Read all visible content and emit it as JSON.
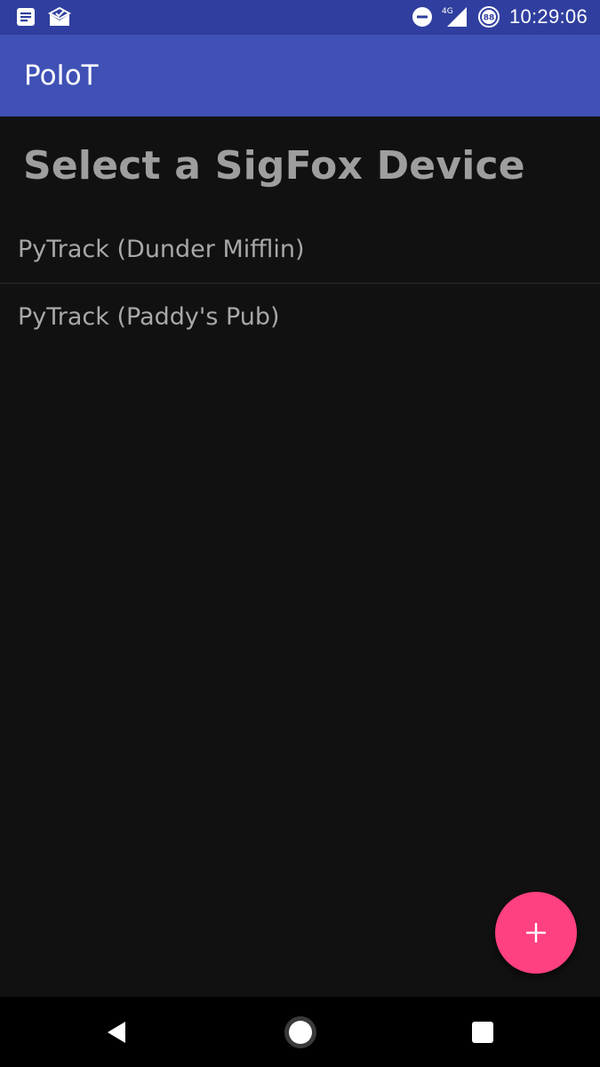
{
  "status_bar": {
    "time": "10:29:06",
    "network": "4G",
    "battery_level": "88",
    "icons_left": [
      "notes-icon",
      "mail-icon"
    ],
    "icons_right": [
      "do-not-disturb-icon",
      "signal-icon",
      "battery-icon"
    ]
  },
  "app_bar": {
    "title": "PoIoT",
    "color": "#3f51b5"
  },
  "main": {
    "heading": "Select a SigFox Device",
    "devices": [
      {
        "label": "PyTrack (Dunder Mifflin)"
      },
      {
        "label": "PyTrack (Paddy's Pub)"
      }
    ]
  },
  "fab": {
    "icon": "plus-icon",
    "color": "#ff4081"
  },
  "nav_bar": {
    "buttons": [
      "back-icon",
      "home-icon",
      "recents-icon"
    ]
  }
}
